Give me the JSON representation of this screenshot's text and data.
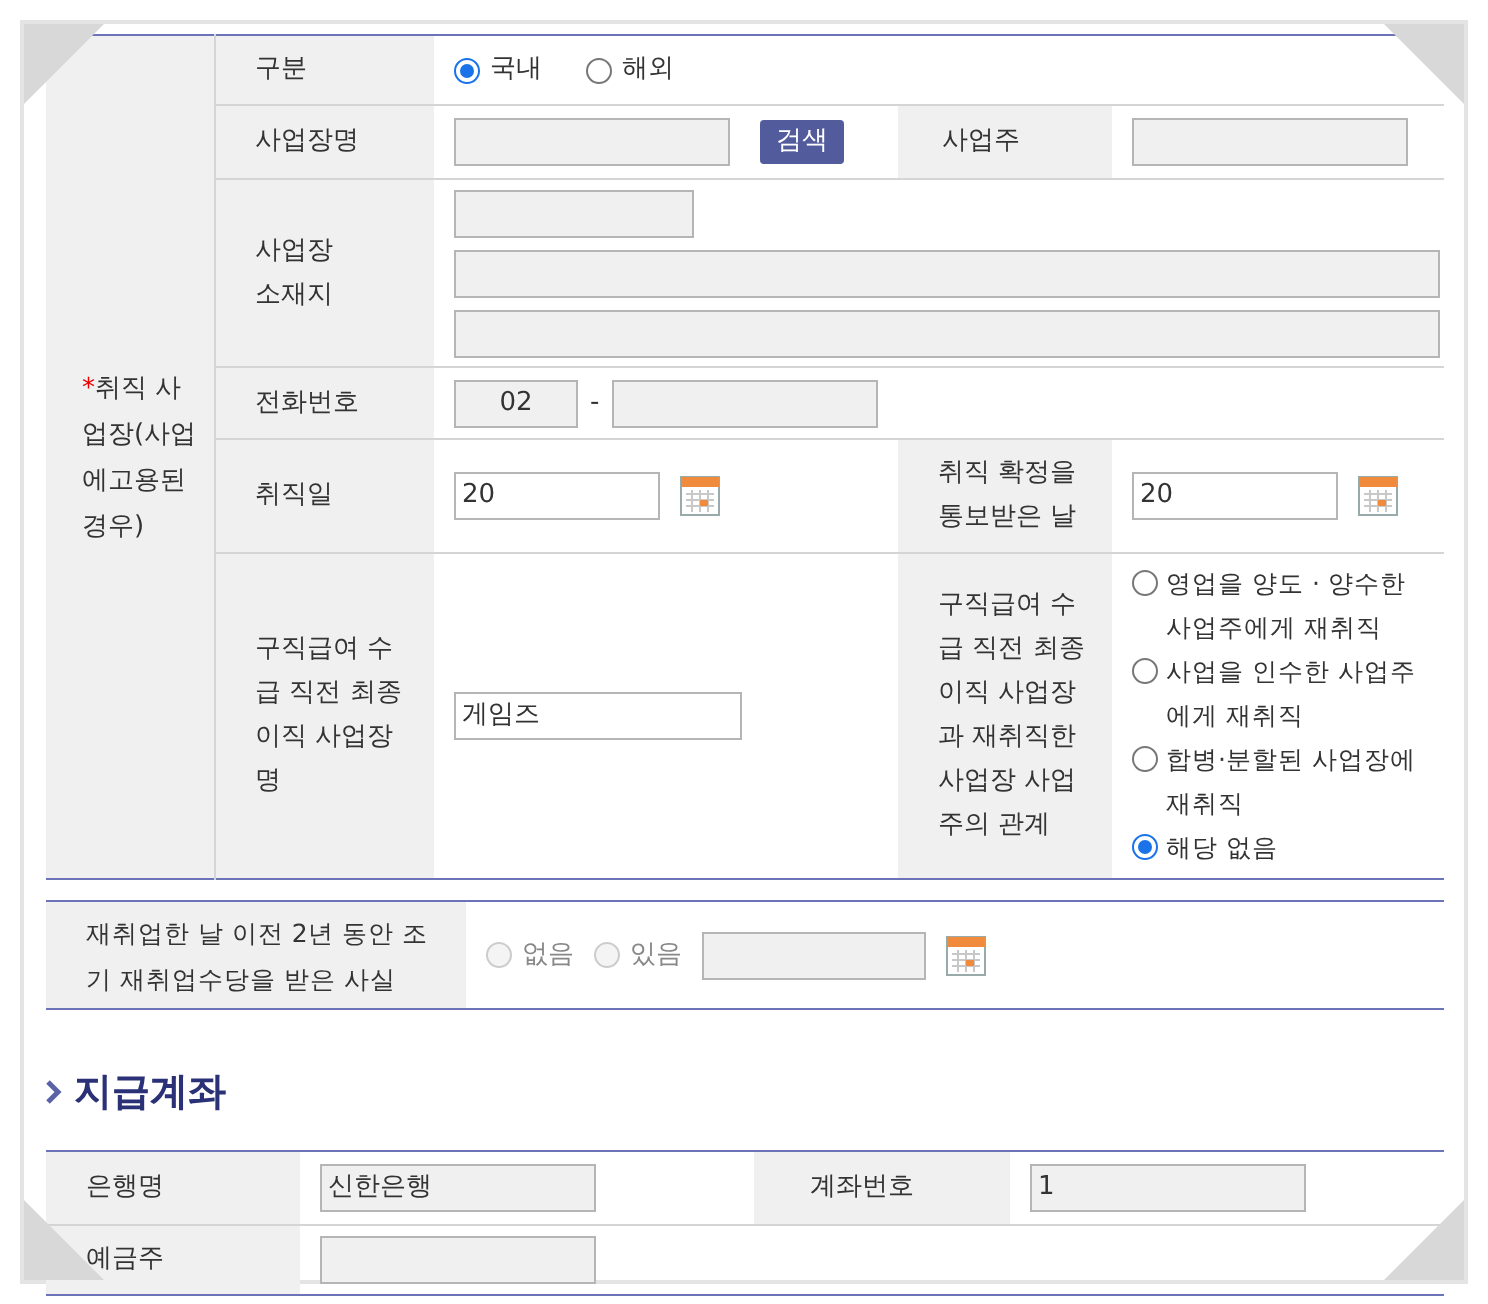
{
  "employment": {
    "required_mark": "*",
    "label": "취직 사업장(사업에고용된 경우)",
    "type": {
      "label": "구분",
      "options": [
        {
          "label": "국내",
          "selected": true
        },
        {
          "label": "해외",
          "selected": false
        }
      ]
    },
    "business_name": {
      "label": "사업장명",
      "readonly": true,
      "button": "검색"
    },
    "owner": {
      "label": "사업주",
      "readonly": true
    },
    "address": {
      "label": "사업장 소재지",
      "fields": [
        {
          "readonly": true
        },
        {
          "readonly": true
        },
        {
          "readonly": true
        }
      ]
    },
    "phone": {
      "label": "전화번호",
      "area": {
        "value": "02",
        "readonly": true
      },
      "separator": "-",
      "number": {
        "readonly": true
      }
    },
    "hire_date": {
      "label": "취직일",
      "value": "20",
      "readonly": false
    },
    "notice_date": {
      "label": "취직 확정을 통보받은 날",
      "value": "20",
      "readonly": false
    },
    "last_workplace": {
      "label": "구직급여 수급 직전 최종 이직 사업장명",
      "value": "게임즈",
      "readonly": false
    },
    "relation": {
      "label": "구직급여 수급 직전 최종 이직 사업장과 재취직한 사업장 사업주의 관계",
      "options": [
        {
          "label": "영업을 양도 · 양수한 사업주에게 재취직",
          "selected": false
        },
        {
          "label": "사업을 인수한 사업주에게 재취직",
          "selected": false
        },
        {
          "label": "합병·분할된 사업장에 재취직",
          "selected": false
        },
        {
          "label": "해당 없음",
          "selected": true
        }
      ]
    }
  },
  "early_allowance": {
    "label": "재취업한 날 이전 2년 동안 조기 재취업수당을 받은 사실",
    "options": [
      {
        "label": "없음",
        "selected": false,
        "disabled": true
      },
      {
        "label": "있음",
        "selected": false,
        "disabled": true
      }
    ],
    "date": {
      "readonly": true
    }
  },
  "account": {
    "title": "지급계좌",
    "bank": {
      "label": "은행명",
      "value": "신한은행",
      "readonly": true
    },
    "number": {
      "label": "계좌번호",
      "value": "1",
      "readonly": true
    },
    "holder": {
      "label": "예금주",
      "readonly": true
    }
  }
}
